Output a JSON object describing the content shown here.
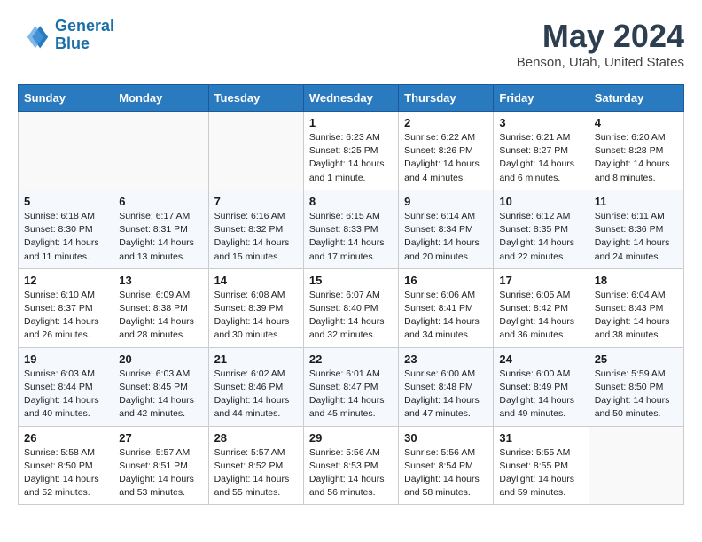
{
  "header": {
    "logo_line1": "General",
    "logo_line2": "Blue",
    "month": "May 2024",
    "location": "Benson, Utah, United States"
  },
  "weekdays": [
    "Sunday",
    "Monday",
    "Tuesday",
    "Wednesday",
    "Thursday",
    "Friday",
    "Saturday"
  ],
  "weeks": [
    [
      {
        "day": "",
        "detail": ""
      },
      {
        "day": "",
        "detail": ""
      },
      {
        "day": "",
        "detail": ""
      },
      {
        "day": "1",
        "detail": "Sunrise: 6:23 AM\nSunset: 8:25 PM\nDaylight: 14 hours\nand 1 minute."
      },
      {
        "day": "2",
        "detail": "Sunrise: 6:22 AM\nSunset: 8:26 PM\nDaylight: 14 hours\nand 4 minutes."
      },
      {
        "day": "3",
        "detail": "Sunrise: 6:21 AM\nSunset: 8:27 PM\nDaylight: 14 hours\nand 6 minutes."
      },
      {
        "day": "4",
        "detail": "Sunrise: 6:20 AM\nSunset: 8:28 PM\nDaylight: 14 hours\nand 8 minutes."
      }
    ],
    [
      {
        "day": "5",
        "detail": "Sunrise: 6:18 AM\nSunset: 8:30 PM\nDaylight: 14 hours\nand 11 minutes."
      },
      {
        "day": "6",
        "detail": "Sunrise: 6:17 AM\nSunset: 8:31 PM\nDaylight: 14 hours\nand 13 minutes."
      },
      {
        "day": "7",
        "detail": "Sunrise: 6:16 AM\nSunset: 8:32 PM\nDaylight: 14 hours\nand 15 minutes."
      },
      {
        "day": "8",
        "detail": "Sunrise: 6:15 AM\nSunset: 8:33 PM\nDaylight: 14 hours\nand 17 minutes."
      },
      {
        "day": "9",
        "detail": "Sunrise: 6:14 AM\nSunset: 8:34 PM\nDaylight: 14 hours\nand 20 minutes."
      },
      {
        "day": "10",
        "detail": "Sunrise: 6:12 AM\nSunset: 8:35 PM\nDaylight: 14 hours\nand 22 minutes."
      },
      {
        "day": "11",
        "detail": "Sunrise: 6:11 AM\nSunset: 8:36 PM\nDaylight: 14 hours\nand 24 minutes."
      }
    ],
    [
      {
        "day": "12",
        "detail": "Sunrise: 6:10 AM\nSunset: 8:37 PM\nDaylight: 14 hours\nand 26 minutes."
      },
      {
        "day": "13",
        "detail": "Sunrise: 6:09 AM\nSunset: 8:38 PM\nDaylight: 14 hours\nand 28 minutes."
      },
      {
        "day": "14",
        "detail": "Sunrise: 6:08 AM\nSunset: 8:39 PM\nDaylight: 14 hours\nand 30 minutes."
      },
      {
        "day": "15",
        "detail": "Sunrise: 6:07 AM\nSunset: 8:40 PM\nDaylight: 14 hours\nand 32 minutes."
      },
      {
        "day": "16",
        "detail": "Sunrise: 6:06 AM\nSunset: 8:41 PM\nDaylight: 14 hours\nand 34 minutes."
      },
      {
        "day": "17",
        "detail": "Sunrise: 6:05 AM\nSunset: 8:42 PM\nDaylight: 14 hours\nand 36 minutes."
      },
      {
        "day": "18",
        "detail": "Sunrise: 6:04 AM\nSunset: 8:43 PM\nDaylight: 14 hours\nand 38 minutes."
      }
    ],
    [
      {
        "day": "19",
        "detail": "Sunrise: 6:03 AM\nSunset: 8:44 PM\nDaylight: 14 hours\nand 40 minutes."
      },
      {
        "day": "20",
        "detail": "Sunrise: 6:03 AM\nSunset: 8:45 PM\nDaylight: 14 hours\nand 42 minutes."
      },
      {
        "day": "21",
        "detail": "Sunrise: 6:02 AM\nSunset: 8:46 PM\nDaylight: 14 hours\nand 44 minutes."
      },
      {
        "day": "22",
        "detail": "Sunrise: 6:01 AM\nSunset: 8:47 PM\nDaylight: 14 hours\nand 45 minutes."
      },
      {
        "day": "23",
        "detail": "Sunrise: 6:00 AM\nSunset: 8:48 PM\nDaylight: 14 hours\nand 47 minutes."
      },
      {
        "day": "24",
        "detail": "Sunrise: 6:00 AM\nSunset: 8:49 PM\nDaylight: 14 hours\nand 49 minutes."
      },
      {
        "day": "25",
        "detail": "Sunrise: 5:59 AM\nSunset: 8:50 PM\nDaylight: 14 hours\nand 50 minutes."
      }
    ],
    [
      {
        "day": "26",
        "detail": "Sunrise: 5:58 AM\nSunset: 8:50 PM\nDaylight: 14 hours\nand 52 minutes."
      },
      {
        "day": "27",
        "detail": "Sunrise: 5:57 AM\nSunset: 8:51 PM\nDaylight: 14 hours\nand 53 minutes."
      },
      {
        "day": "28",
        "detail": "Sunrise: 5:57 AM\nSunset: 8:52 PM\nDaylight: 14 hours\nand 55 minutes."
      },
      {
        "day": "29",
        "detail": "Sunrise: 5:56 AM\nSunset: 8:53 PM\nDaylight: 14 hours\nand 56 minutes."
      },
      {
        "day": "30",
        "detail": "Sunrise: 5:56 AM\nSunset: 8:54 PM\nDaylight: 14 hours\nand 58 minutes."
      },
      {
        "day": "31",
        "detail": "Sunrise: 5:55 AM\nSunset: 8:55 PM\nDaylight: 14 hours\nand 59 minutes."
      },
      {
        "day": "",
        "detail": ""
      }
    ]
  ]
}
